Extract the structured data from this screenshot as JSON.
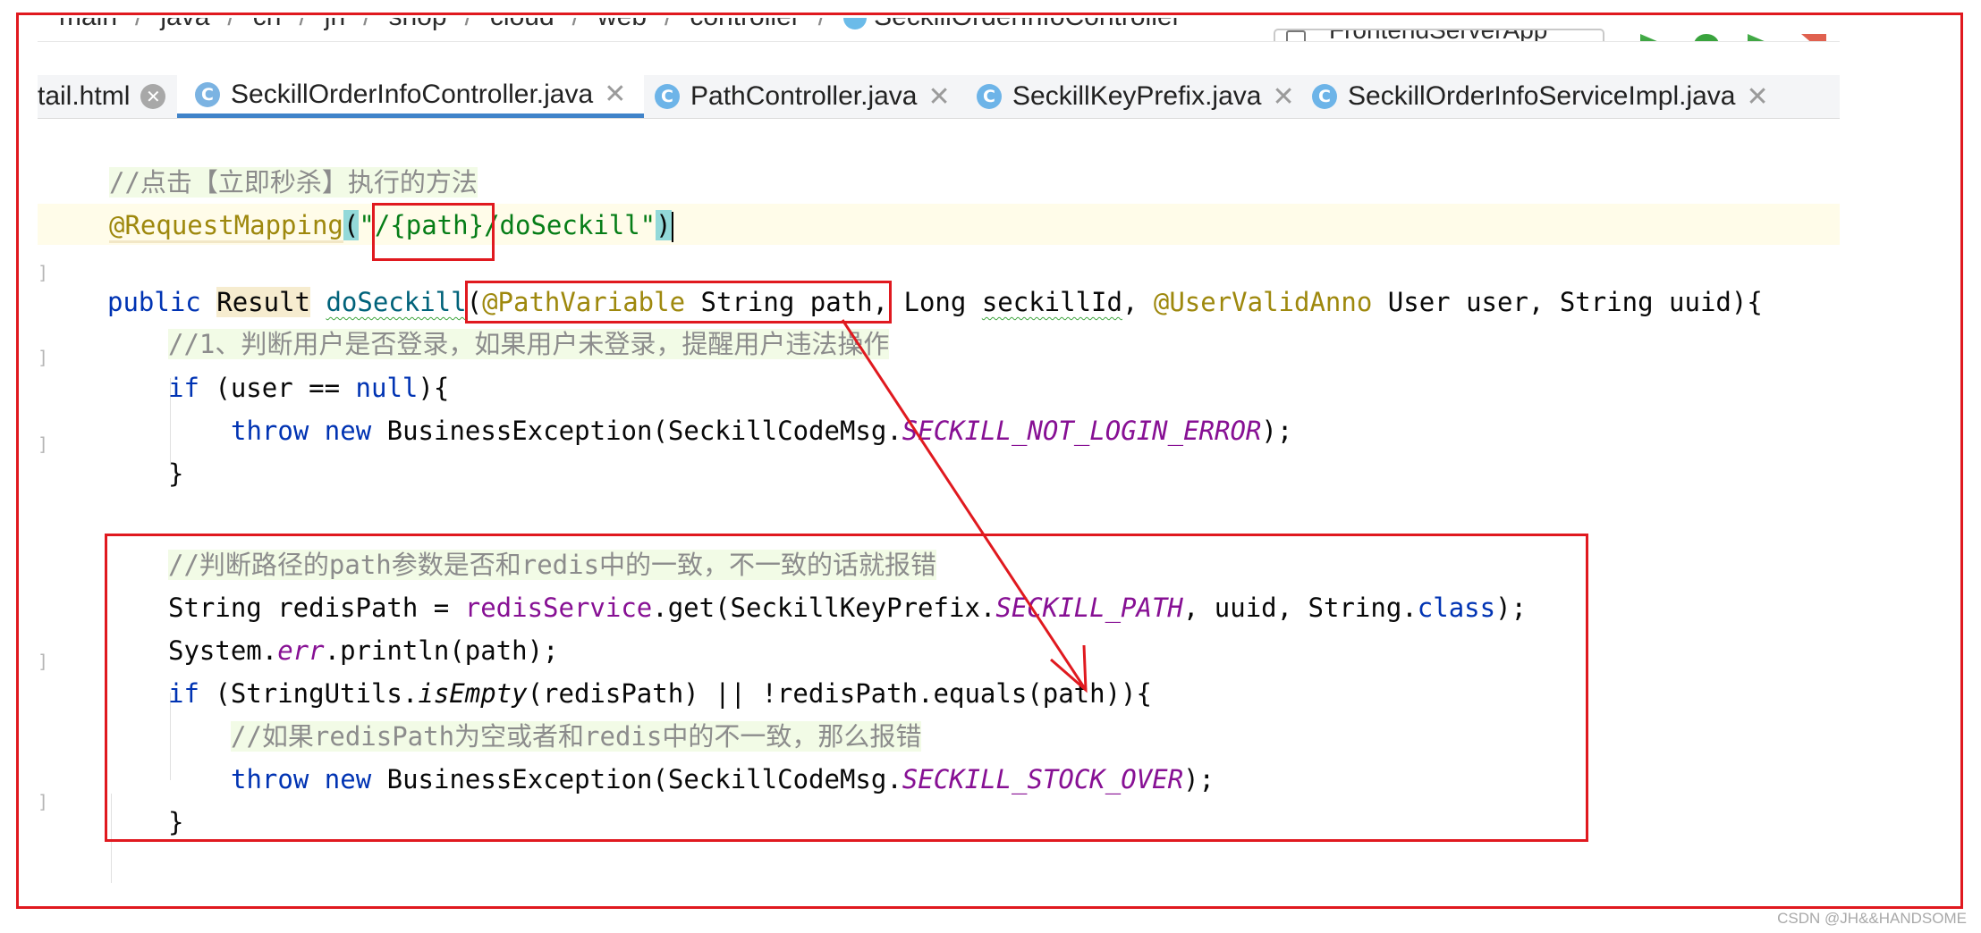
{
  "breadcrumb": {
    "items": [
      "main",
      "java",
      "cn",
      "jh",
      "shop",
      "cloud",
      "web",
      "controller",
      "SeckillOrderInfoController"
    ]
  },
  "toolbar": {
    "run_config": "FrontendServerApp"
  },
  "tabs": [
    {
      "label": "tail.html",
      "icon": "html-file-icon",
      "active": false
    },
    {
      "label": "SeckillOrderInfoController.java",
      "icon": "class-c-icon",
      "active": true
    },
    {
      "label": "PathController.java",
      "icon": "class-c-icon",
      "active": false
    },
    {
      "label": "SeckillKeyPrefix.java",
      "icon": "class-c-icon",
      "active": false
    },
    {
      "label": "SeckillOrderInfoServiceImpl.java",
      "icon": "class-c-icon",
      "active": false
    }
  ],
  "code": {
    "l1": {
      "comment": "//点击【立即秒杀】执行的方法"
    },
    "l2": {
      "annotation": "@RequestMapping",
      "open": "(",
      "q1": "\"",
      "path_var": "/{path}",
      "rest": "/doSeckill",
      "q2": "\"",
      "close": ")"
    },
    "l3": {
      "kw_public": "public",
      "type_result": "Result",
      "method": "doSeckill",
      "paren": "(",
      "ann_path": "@PathVariable",
      "p1": " String path,",
      "p2": " Long ",
      "p2b": "seckillId",
      "p2c": ", ",
      "ann_user": "@UserValidAnno",
      "p3": " User user, String uuid){"
    },
    "l4": {
      "comment": "//1、判断用户是否登录，如果用户未登录，提醒用户违法操作"
    },
    "l5": {
      "kw_if": "if",
      "p1": " (user == ",
      "kw_null": "null",
      "p2": "){"
    },
    "l6": {
      "kw_throw": "throw",
      "kw_new": "new",
      "p1": " BusinessException(SeckillCodeMsg.",
      "const": "SECKILL_NOT_LOGIN_ERROR",
      "p2": ");"
    },
    "l7": {
      "text": "}"
    },
    "l8": {
      "comment": "//判断路径的path参数是否和redis中的一致，不一致的话就报错"
    },
    "l9": {
      "p1": "String redisPath = ",
      "field": "redisService",
      "p2": ".get(SeckillKeyPrefix.",
      "const": "SECKILL_PATH",
      "p3": ", uuid, String.",
      "kw_class": "class",
      "p4": ");"
    },
    "l10": {
      "p1": "System.",
      "field": "err",
      "p2": ".println(path);"
    },
    "l11": {
      "kw_if": "if",
      "p1": " (StringUtils.",
      "static_m": "isEmpty",
      "p2": "(redisPath) || !redisPath.equals(path)){"
    },
    "l12": {
      "comment": "//如果redisPath为空或者和redis中的不一致，那么报错"
    },
    "l13": {
      "kw_throw": "throw",
      "kw_new": "new",
      "p1": " BusinessException(SeckillCodeMsg.",
      "const": "SECKILL_STOCK_OVER",
      "p2": ");"
    },
    "l14": {
      "text": "}"
    }
  },
  "colors": {
    "annotation_red": "#e0191f",
    "keyword": "#0033b3",
    "string": "#067d17",
    "constant": "#871094",
    "comment": "#8c8c8c"
  },
  "watermark": "CSDN @JH&&HANDSOME"
}
